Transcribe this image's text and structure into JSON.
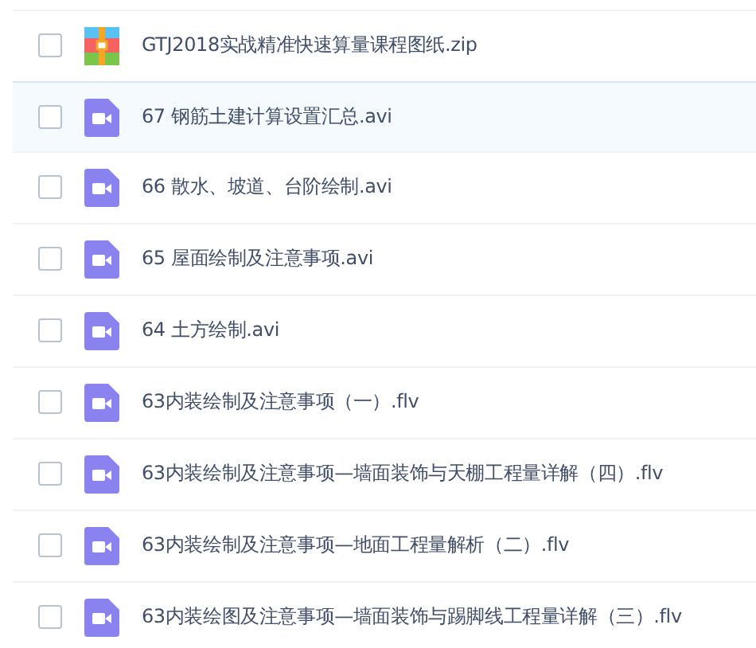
{
  "files": [
    {
      "name": "GTJ2018实战精准快速算量课程图纸.zip",
      "kind": "archive",
      "checked": false,
      "highlighted": false
    },
    {
      "name": "67 钢筋土建计算设置汇总.avi",
      "kind": "video",
      "checked": false,
      "highlighted": true
    },
    {
      "name": "66 散水、坡道、台阶绘制.avi",
      "kind": "video",
      "checked": false,
      "highlighted": false
    },
    {
      "name": "65 屋面绘制及注意事项.avi",
      "kind": "video",
      "checked": false,
      "highlighted": false
    },
    {
      "name": "64 土方绘制.avi",
      "kind": "video",
      "checked": false,
      "highlighted": false
    },
    {
      "name": "63内装绘制及注意事项（一）.flv",
      "kind": "video",
      "checked": false,
      "highlighted": false
    },
    {
      "name": "63内装绘制及注意事项—墙面装饰与天棚工程量详解（四）.flv",
      "kind": "video",
      "checked": false,
      "highlighted": false
    },
    {
      "name": "63内装绘制及注意事项—地面工程量解析（二）.flv",
      "kind": "video",
      "checked": false,
      "highlighted": false
    },
    {
      "name": "63内装绘图及注意事项—墙面装饰与踢脚线工程量详解（三）.flv",
      "kind": "video",
      "checked": false,
      "highlighted": false
    }
  ]
}
